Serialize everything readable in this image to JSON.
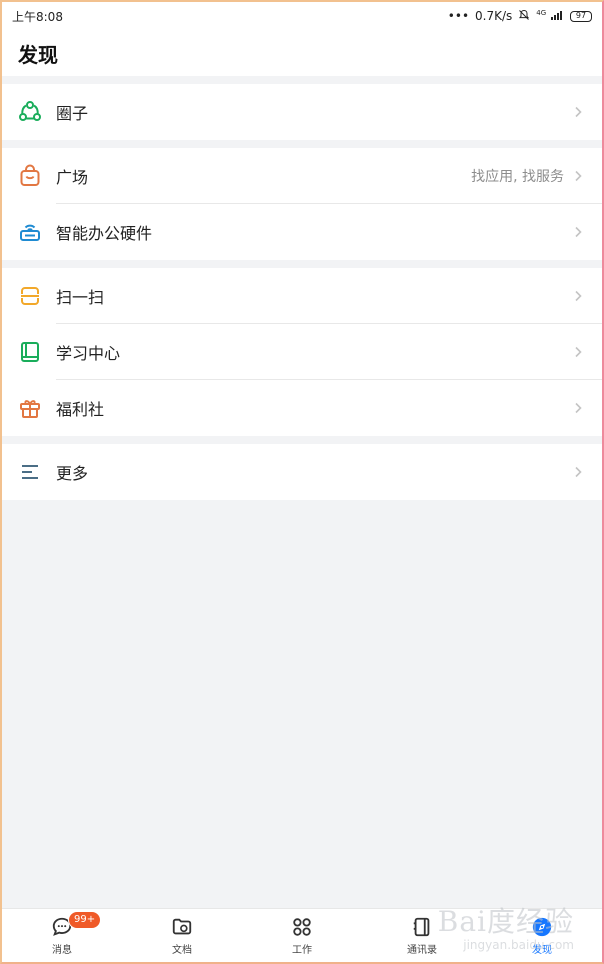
{
  "statusbar": {
    "time": "上午8:08",
    "net_speed": "0.7K/s",
    "network_type": "4G",
    "battery": "97"
  },
  "header": {
    "title": "发现"
  },
  "menu": {
    "group1": [
      {
        "label": "圈子",
        "icon": "circle-network-icon"
      }
    ],
    "group2": [
      {
        "label": "广场",
        "subtext": "找应用, 找服务",
        "icon": "shopping-bag-icon"
      },
      {
        "label": "智能办公硬件",
        "icon": "router-icon"
      }
    ],
    "group3": [
      {
        "label": "扫一扫",
        "icon": "scan-icon"
      },
      {
        "label": "学习中心",
        "icon": "book-icon"
      },
      {
        "label": "福利社",
        "icon": "gift-icon"
      }
    ],
    "group4": [
      {
        "label": "更多",
        "icon": "more-lines-icon"
      }
    ]
  },
  "tabbar": {
    "tabs": [
      {
        "label": "消息",
        "icon": "message-icon",
        "badge": "99+"
      },
      {
        "label": "文档",
        "icon": "folder-icon"
      },
      {
        "label": "工作",
        "icon": "apps-grid-icon"
      },
      {
        "label": "通讯录",
        "icon": "contacts-icon"
      },
      {
        "label": "发现",
        "icon": "discover-icon",
        "active": true
      }
    ]
  },
  "watermark": {
    "main": "Bai度经验",
    "sub": "jingyan.baidu.com"
  },
  "colors": {
    "green": "#1aad5b",
    "orange": "#e27742",
    "blue": "#1f8bd2",
    "yellow": "#f2a82a",
    "slate": "#4b6e86",
    "badge": "#ef5a28",
    "active": "#1677ff"
  }
}
